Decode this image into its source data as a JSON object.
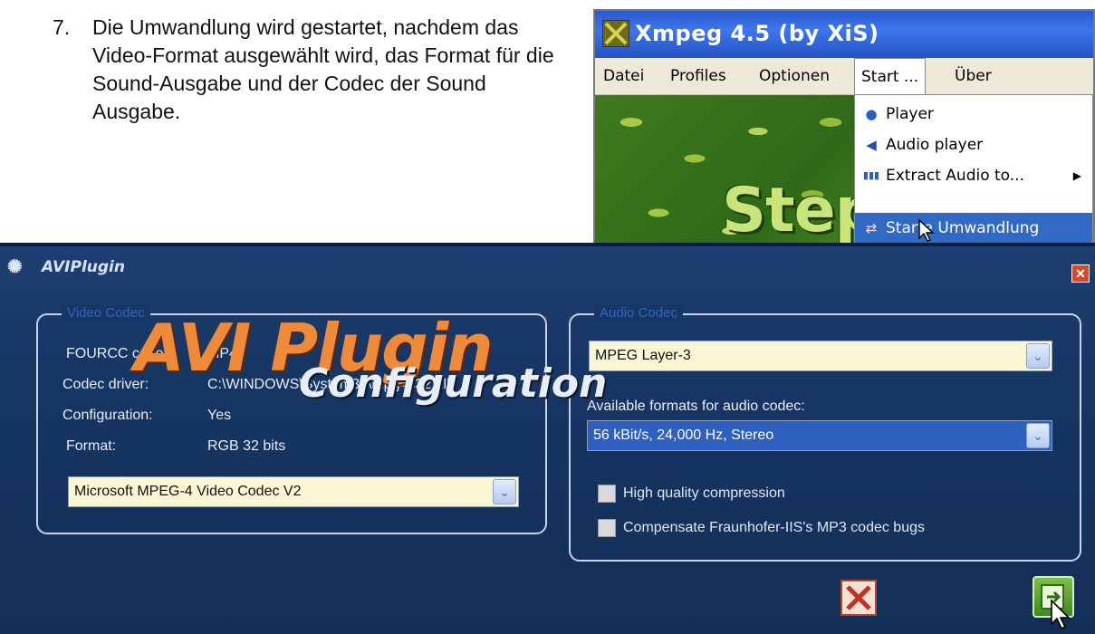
{
  "instruction": {
    "number": "7.",
    "text": "Die Umwandlung wird gestartet, nachdem das Video-Format ausgewählt wird, das Format für die Sound-Ausgabe und der Codec der Sound Ausgabe."
  },
  "xmpeg": {
    "title": "Xmpeg 4.5  (by XiS)",
    "menu": [
      "Datei",
      "Profiles",
      "Optionen",
      "Start ...",
      "Über"
    ],
    "banner_text": "Step",
    "dropdown": [
      {
        "label": "Player",
        "icon": "player-icon"
      },
      {
        "label": "Audio player",
        "icon": "speaker-icon"
      },
      {
        "label": "Extract Audio to...",
        "icon": "waveform-icon"
      },
      {
        "label": "Starte Umwandlung",
        "icon": "convert-icon"
      }
    ]
  },
  "dialog": {
    "title": "AVIPlugin",
    "video_group": {
      "legend": "Video Codec",
      "fourcc_label": "FOURCC code:",
      "fourcc_value": "MP42",
      "driver_label": "Codec driver:",
      "driver_value": "C:\\WINDOWS\\System32\\mpg4c32.dll",
      "config_label": "Configuration:",
      "config_value": "Yes",
      "format_label": "Format:",
      "format_value": "RGB 32 bits",
      "codec_select": "Microsoft MPEG-4 Video Codec V2"
    },
    "audio_group": {
      "legend": "Audio Codec",
      "codec_select": "MPEG Layer-3",
      "formats_label": "Available formats for audio codec:",
      "format_select": "56 kBit/s, 24,000 Hz, Stereo",
      "hq_label": "High quality compression",
      "fraunhofer_label": "Compensate Fraunhofer-IIS's MP3 codec bugs"
    },
    "logo_line1": "AVI Plugin",
    "logo_line2": "Configuration"
  }
}
